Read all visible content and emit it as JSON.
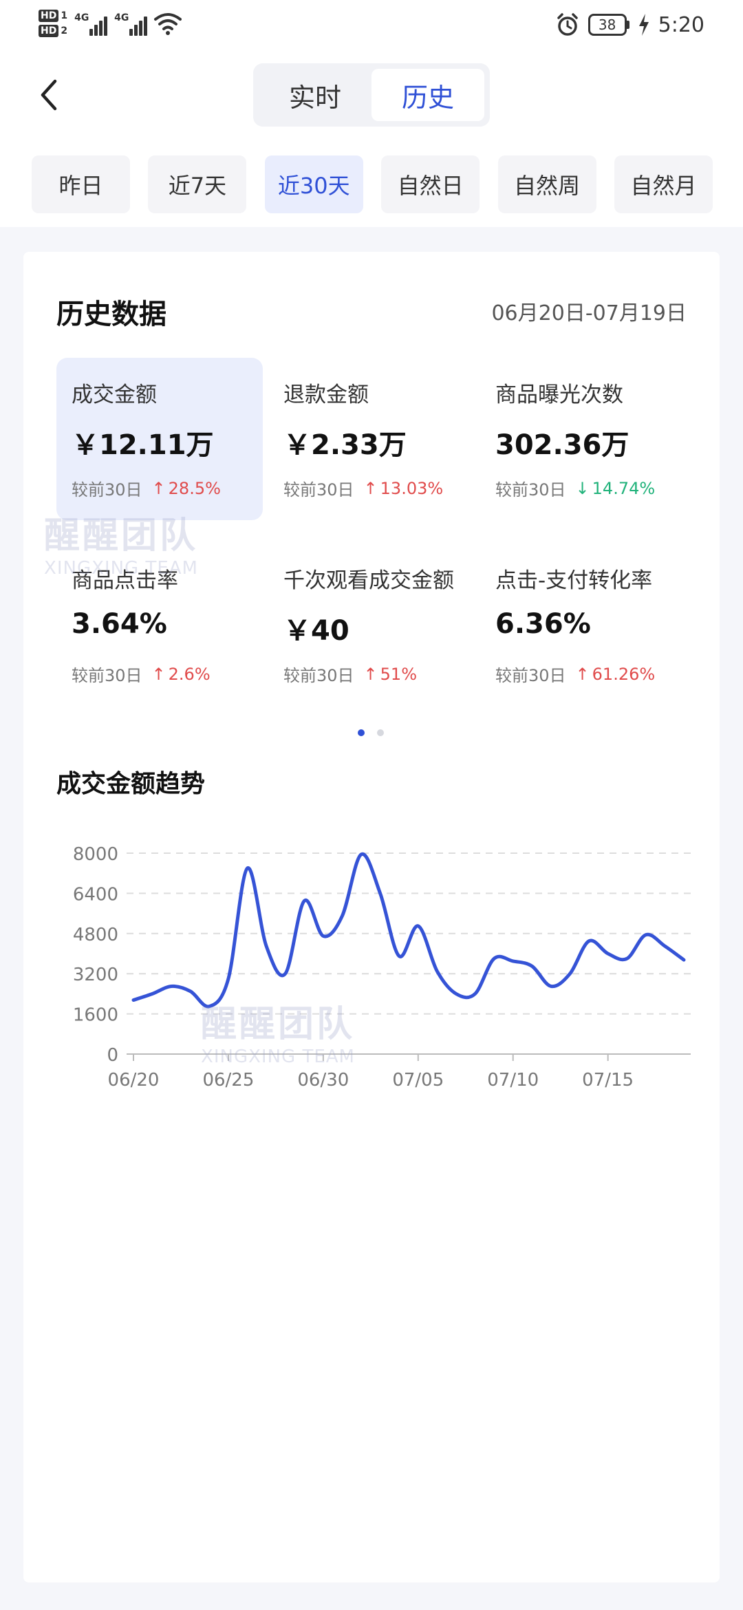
{
  "status_bar": {
    "hd1_label": "HD",
    "hd1_num": "1",
    "hd2_label": "HD",
    "hd2_num": "2",
    "net1": "4G",
    "net2": "4G",
    "battery": "38",
    "time": "5:20",
    "icons": [
      "signal-icon",
      "wifi-icon",
      "alarm-icon",
      "battery-icon",
      "charging-icon"
    ]
  },
  "header": {
    "back_icon": "chevron-left-icon",
    "segments": [
      {
        "label": "实时",
        "active": false
      },
      {
        "label": "历史",
        "active": true
      }
    ]
  },
  "range_filters": [
    {
      "label": "昨日",
      "active": false
    },
    {
      "label": "近7天",
      "active": false
    },
    {
      "label": "近30天",
      "active": true
    },
    {
      "label": "自然日",
      "active": false
    },
    {
      "label": "自然周",
      "active": false
    },
    {
      "label": "自然月",
      "active": false
    }
  ],
  "history": {
    "title": "历史数据",
    "date_range": "06月20日-07月19日",
    "metrics": [
      {
        "label": "成交金额",
        "value": "￥12.11万",
        "compare_base": "较前30日",
        "direction": "up",
        "change": "28.5%"
      },
      {
        "label": "退款金额",
        "value": "￥2.33万",
        "compare_base": "较前30日",
        "direction": "up",
        "change": "13.03%"
      },
      {
        "label": "商品曝光次数",
        "value": "302.36万",
        "compare_base": "较前30日",
        "direction": "down",
        "change": "14.74%"
      },
      {
        "label": "商品点击率",
        "value": "3.64%",
        "compare_base": "较前30日",
        "direction": "up",
        "change": "2.6%"
      },
      {
        "label": "千次观看成交金额",
        "value": "￥40",
        "compare_base": "较前30日",
        "direction": "up",
        "change": "51%"
      },
      {
        "label": "点击-支付转化率",
        "value": "6.36%",
        "compare_base": "较前30日",
        "direction": "up",
        "change": "61.26%"
      }
    ],
    "arrows": {
      "up": "↑",
      "down": "↓"
    },
    "page_dots": {
      "count": 2,
      "active": 0
    }
  },
  "trend": {
    "title": "成交金额趋势"
  },
  "watermark": {
    "cn": "醒醒团队",
    "en": "XINGXING TEAM"
  },
  "colors": {
    "accent": "#2f50d6",
    "up": "#e04b4b",
    "down": "#20b27a",
    "line": "#3553d6",
    "grid": "#dcdcdc"
  },
  "chart_data": {
    "type": "line",
    "title": "成交金额趋势",
    "xlabel": "",
    "ylabel": "",
    "ylim": [
      0,
      8000
    ],
    "yticks": [
      0,
      1600,
      3200,
      4800,
      6400,
      8000
    ],
    "xticks": [
      "06/20",
      "06/25",
      "06/30",
      "07/05",
      "07/10",
      "07/15"
    ],
    "grid": true,
    "x": [
      "06/20",
      "06/21",
      "06/22",
      "06/23",
      "06/24",
      "06/25",
      "06/26",
      "06/27",
      "06/28",
      "06/29",
      "06/30",
      "07/01",
      "07/02",
      "07/03",
      "07/04",
      "07/05",
      "07/06",
      "07/07",
      "07/08",
      "07/09",
      "07/10",
      "07/11",
      "07/12",
      "07/13",
      "07/14",
      "07/15",
      "07/16",
      "07/17",
      "07/18",
      "07/19"
    ],
    "series": [
      {
        "values": [
          2150,
          2400,
          2700,
          2500,
          1900,
          3000,
          7400,
          4300,
          3200,
          6100,
          4700,
          5500,
          7950,
          6400,
          3900,
          5100,
          3300,
          2400,
          2400,
          3800,
          3700,
          3500,
          2700,
          3200,
          4500,
          4000,
          3800,
          4750,
          4300,
          3750
        ]
      }
    ]
  }
}
